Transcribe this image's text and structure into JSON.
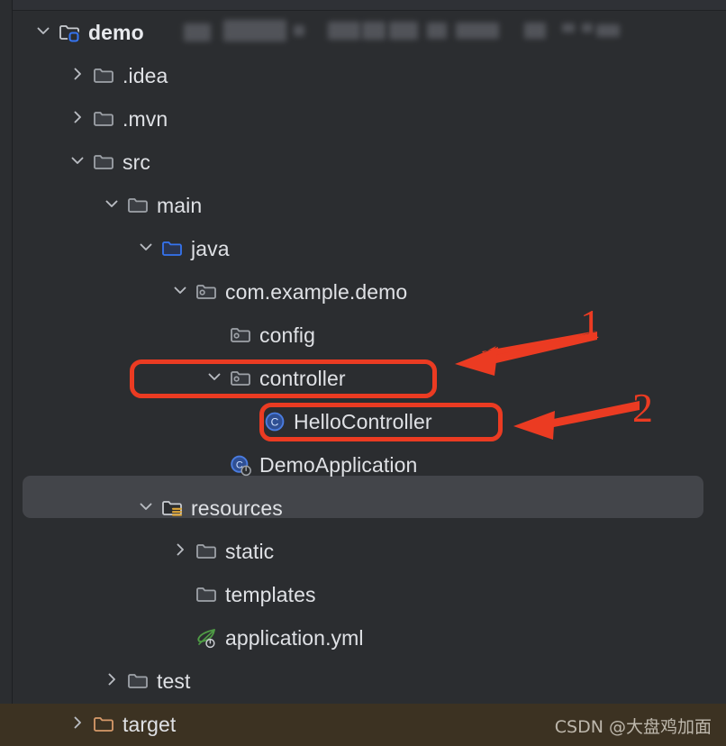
{
  "window": {
    "background_color": "#2b2d30",
    "selected_row_color": "#43454a",
    "target_row_color": "#3c3222",
    "annotation_color": "#eb3b22",
    "accent_blue": "#3574f0"
  },
  "project_tree": {
    "rows": [
      {
        "id": "demo",
        "label": "demo",
        "depth": 0,
        "chevron": "chevron-down",
        "icon": "module-folder-icon",
        "bold": true,
        "state": "expanded"
      },
      {
        "id": "idea",
        "label": ".idea",
        "depth": 1,
        "chevron": "chevron-right",
        "icon": "folder-icon",
        "bold": false,
        "state": "collapsed"
      },
      {
        "id": "mvn",
        "label": ".mvn",
        "depth": 1,
        "chevron": "chevron-right",
        "icon": "folder-icon",
        "bold": false,
        "state": "collapsed"
      },
      {
        "id": "src",
        "label": "src",
        "depth": 1,
        "chevron": "chevron-down",
        "icon": "folder-icon",
        "bold": false,
        "state": "expanded"
      },
      {
        "id": "main",
        "label": "main",
        "depth": 2,
        "chevron": "chevron-down",
        "icon": "folder-icon",
        "bold": false,
        "state": "expanded"
      },
      {
        "id": "java",
        "label": "java",
        "depth": 3,
        "chevron": "chevron-down",
        "icon": "source-root-folder-icon",
        "bold": false,
        "state": "expanded"
      },
      {
        "id": "com-example-demo",
        "label": "com.example.demo",
        "depth": 4,
        "chevron": "chevron-down",
        "icon": "package-icon",
        "bold": false,
        "state": "expanded"
      },
      {
        "id": "config",
        "label": "config",
        "depth": 5,
        "chevron": "none",
        "icon": "package-icon",
        "bold": false,
        "state": "leaf"
      },
      {
        "id": "controller",
        "label": "controller",
        "depth": 5,
        "chevron": "chevron-down",
        "icon": "package-icon",
        "bold": false,
        "state": "expanded"
      },
      {
        "id": "hellocontroller",
        "label": "HelloController",
        "depth": 6,
        "chevron": "none",
        "icon": "java-class-icon",
        "bold": false,
        "state": "leaf"
      },
      {
        "id": "demoapplication",
        "label": "DemoApplication",
        "depth": 5,
        "chevron": "none",
        "icon": "spring-boot-class-icon",
        "bold": false,
        "state": "leaf"
      },
      {
        "id": "resources",
        "label": "resources",
        "depth": 3,
        "chevron": "chevron-down",
        "icon": "resource-root-folder-icon",
        "bold": false,
        "state": "expanded"
      },
      {
        "id": "static",
        "label": "static",
        "depth": 4,
        "chevron": "chevron-right",
        "icon": "folder-icon",
        "bold": false,
        "state": "collapsed"
      },
      {
        "id": "templates",
        "label": "templates",
        "depth": 4,
        "chevron": "none",
        "icon": "folder-icon",
        "bold": false,
        "state": "leaf"
      },
      {
        "id": "application-yml",
        "label": "application.yml",
        "depth": 4,
        "chevron": "none",
        "icon": "spring-yaml-icon",
        "bold": false,
        "state": "leaf"
      },
      {
        "id": "test",
        "label": "test",
        "depth": 2,
        "chevron": "chevron-right",
        "icon": "folder-icon",
        "bold": false,
        "state": "collapsed"
      },
      {
        "id": "target",
        "label": "target",
        "depth": 1,
        "chevron": "chevron-right",
        "icon": "excluded-folder-icon",
        "bold": false,
        "state": "collapsed"
      }
    ],
    "selected_row": "resources",
    "excluded_row": "target"
  },
  "annotations": {
    "markers": [
      {
        "id": "marker-1",
        "label": "1",
        "points_to": "controller"
      },
      {
        "id": "marker-2",
        "label": "2",
        "points_to": "HelloController"
      }
    ],
    "highlight_boxes": [
      {
        "id": "controller-highlight",
        "target": "controller"
      },
      {
        "id": "hellocontroller-highlight",
        "target": "HelloController"
      }
    ]
  },
  "watermark": {
    "text": "CSDN @大盘鸡加面"
  }
}
